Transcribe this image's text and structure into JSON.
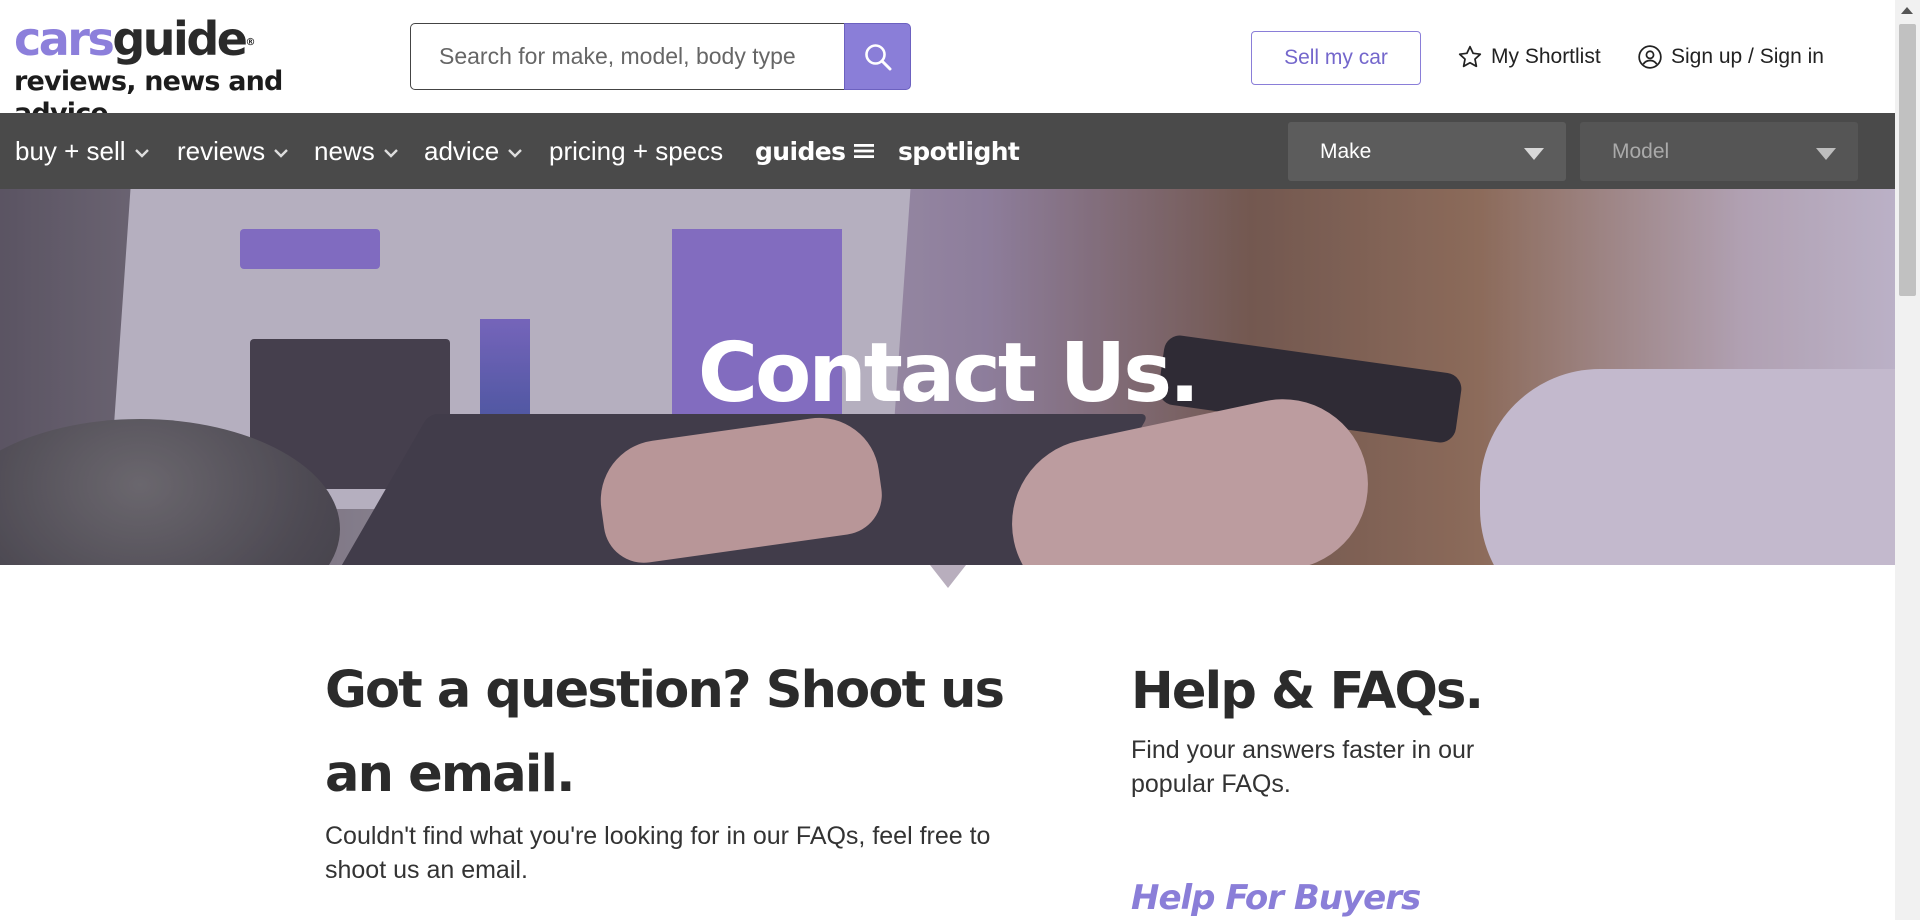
{
  "header": {
    "logo": {
      "part1": "cars",
      "part2": "guide",
      "reg": "®",
      "tagline": "reviews, news and advice"
    },
    "search": {
      "placeholder": "Search for make, model, body type",
      "icon": "search-icon"
    },
    "sell_label": "Sell my car",
    "shortlist_label": "My Shortlist",
    "shortlist_icon": "star-icon",
    "signin_label": "Sign up / Sign in",
    "signin_icon": "user-circle-icon"
  },
  "nav": {
    "items": [
      {
        "label": "buy + sell",
        "dropdown": true
      },
      {
        "label": "reviews",
        "dropdown": true
      },
      {
        "label": "news",
        "dropdown": true
      },
      {
        "label": "advice",
        "dropdown": true
      },
      {
        "label": "pricing + specs",
        "dropdown": false
      },
      {
        "label": "guides",
        "icon": "hamburger-menu-icon"
      },
      {
        "label": "spotlight"
      }
    ],
    "make_select": {
      "label": "Make"
    },
    "model_select": {
      "label": "Model"
    }
  },
  "hero": {
    "title": "Contact Us."
  },
  "contact": {
    "heading": "Got a question? Shoot us an email.",
    "text": "Couldn't find what you're looking for in our FAQs, feel free to shoot us an email."
  },
  "faqs": {
    "heading": "Help & FAQs.",
    "text": "Find your answers faster in our popular FAQs.",
    "buyers_link": "Help For Buyers"
  },
  "colors": {
    "accent": "#8a7ed8",
    "nav_bg": "#4a4a4a",
    "text": "#333333"
  }
}
